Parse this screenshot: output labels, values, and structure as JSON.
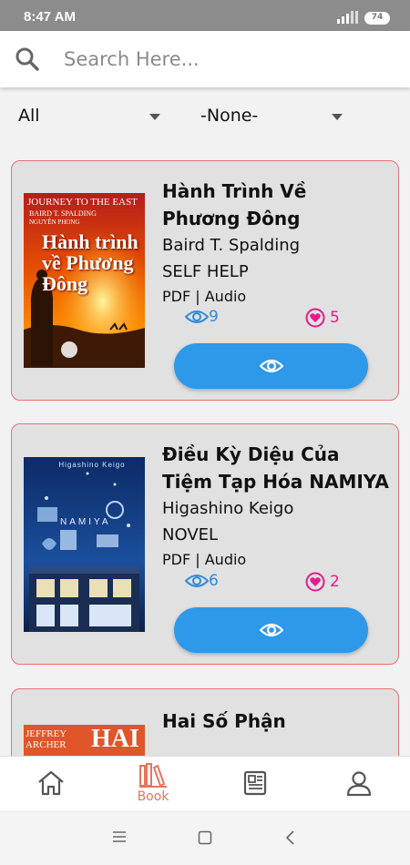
{
  "status_bar": {
    "time": "8:47 AM",
    "signal": "signal-icon",
    "battery": "74"
  },
  "search": {
    "placeholder": "Search Here...",
    "icon": "search-icon"
  },
  "filters": {
    "category_value": "All",
    "sort_value": "-None-"
  },
  "books": [
    {
      "title": "Hành Trình Về Phương Đông",
      "author": "Baird T. Spalding",
      "category": "SELF HELP",
      "formats": "PDF | Audio",
      "views": "9",
      "likes": "5",
      "cover": {
        "top_text": "JOURNEY TO THE EAST",
        "author_line": "BAIRD T. SPALDING",
        "translator": "NGUYÊN PHONG",
        "big_title": "Hành trình về Phương Đông"
      }
    },
    {
      "title": "Điều Kỳ Diệu Của Tiệm Tạp Hóa NAMIYA",
      "author": "Higashino Keigo",
      "category": "NOVEL",
      "formats": "PDF | Audio",
      "views": "6",
      "likes": "2",
      "cover": {
        "top_text": "Higashino Keigo",
        "big_title": "NAMIYA"
      }
    },
    {
      "title": "Hai Số Phận",
      "cover": {
        "top_text": "JEFFREY ARCHER",
        "big_title": "HAI"
      }
    }
  ],
  "bottom_nav": [
    {
      "icon": "home-icon",
      "label": ""
    },
    {
      "icon": "book-icon",
      "label": "Book"
    },
    {
      "icon": "news-icon",
      "label": ""
    },
    {
      "icon": "profile-icon",
      "label": ""
    }
  ],
  "colors": {
    "accent": "#2e98e9",
    "like": "#e8198b",
    "nav_active": "#e8745c",
    "card_border": "#e57373"
  }
}
